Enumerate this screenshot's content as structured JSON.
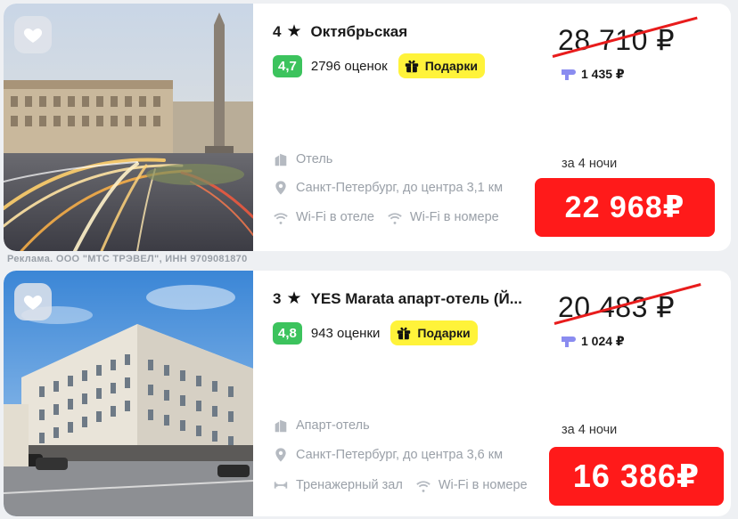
{
  "hotels": [
    {
      "stars": "4",
      "name": "Октябрьская",
      "rating": "4,7",
      "reviews": "2796 оценок",
      "gift_label": "Подарки",
      "type": "Отель",
      "location": "Санкт-Петербург, до центра 3,1 км",
      "amenity_1": "Wi-Fi в отеле",
      "amenity_2": "Wi-Fi в номере",
      "amenity_1_icon": "wifi-icon",
      "amenity_2_icon": "wifi-icon",
      "old_price": "28 710 ₽",
      "cashback": "1 435 ₽",
      "nights": "за 4 ночи",
      "price": "22 968₽"
    },
    {
      "stars": "3",
      "name": "YES Marata апарт-отель (Й...",
      "rating": "4,8",
      "reviews": "943 оценки",
      "gift_label": "Подарки",
      "type": "Апарт-отель",
      "location": "Санкт-Петербург, до центра 3,6 км",
      "amenity_1": "Тренажерный зал",
      "amenity_2": "Wi-Fi в номере",
      "amenity_1_icon": "gym-icon",
      "amenity_2_icon": "wifi-icon",
      "old_price": "20 483 ₽",
      "cashback": "1 024 ₽",
      "nights": "за 4 ночи",
      "price": "16 386₽"
    }
  ],
  "ad_note": "Реклама. ООО \"МТС ТРЭВЕЛ\", ИНН 9709081870",
  "colors": {
    "rating_green": "#3cc35d",
    "gift_yellow": "#fff33a",
    "price_red": "#ff1a1a",
    "strike_red": "#e81c1c",
    "cashback_purple": "#8a8cf0"
  }
}
